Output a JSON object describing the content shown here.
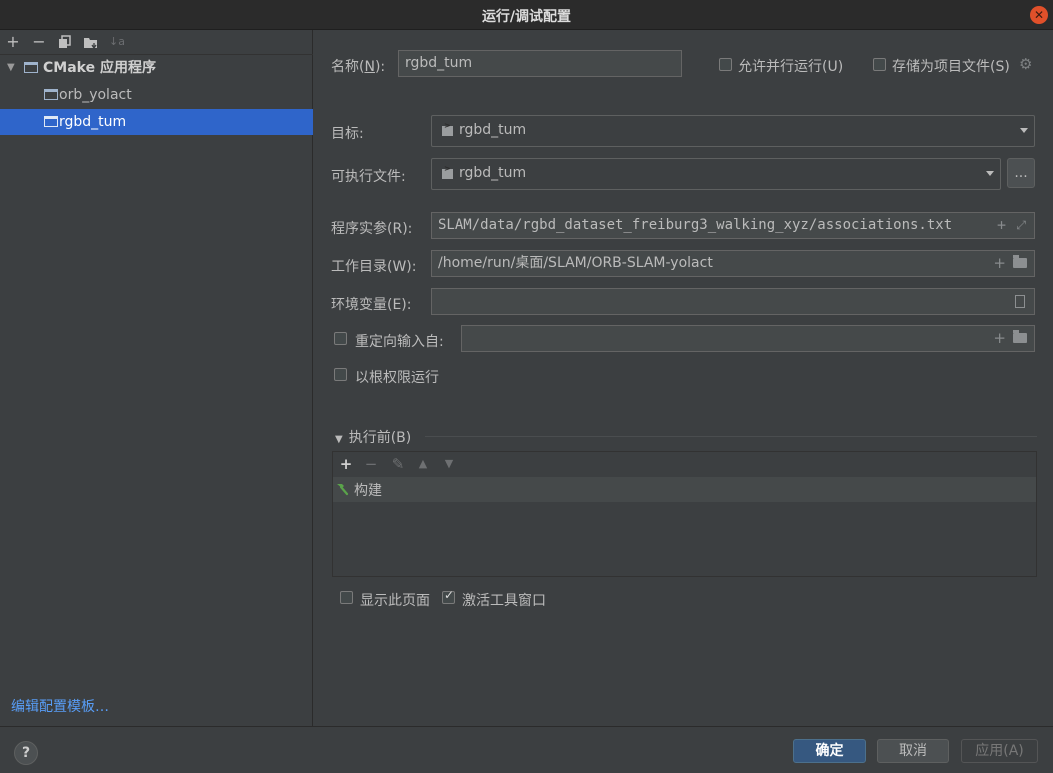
{
  "window": {
    "title": "运行/调试配置"
  },
  "left_panel": {
    "toolbar": [
      "+",
      "−",
      "copy",
      "folder",
      "sort"
    ],
    "group_label": "CMake 应用程序",
    "items": [
      {
        "label": "orb_yolact",
        "selected": false
      },
      {
        "label": "rgbd_tum",
        "selected": true
      }
    ],
    "edit_templates_link": "编辑配置模板…"
  },
  "form": {
    "name_label": "名称(",
    "name_mnemonic": "N",
    "name_label_end": "):",
    "name_value": "rgbd_tum",
    "allow_parallel_label": "允许并行运行(U)",
    "allow_parallel_checked": false,
    "store_as_project_label": "存储为项目文件(S)",
    "store_as_project_checked": false,
    "target_label": "目标:",
    "target_value": "rgbd_tum",
    "executable_label": "可执行文件:",
    "executable_value": "rgbd_tum",
    "dots_label": "...",
    "program_args_label": "程序实参(R):",
    "program_args_value": "SLAM/data/rgbd_dataset_freiburg3_walking_xyz/associations.txt",
    "working_dir_label": "工作目录(W):",
    "working_dir_value": "/home/run/桌面/SLAM/ORB-SLAM-yolact",
    "env_label": "环境变量(E):",
    "env_value": "",
    "redirect_label": "重定向输入自:",
    "redirect_checked": false,
    "redirect_value": "",
    "run_as_root_label": "以根权限运行",
    "run_as_root_checked": false
  },
  "before_launch": {
    "title": "执行前(B)",
    "items": [
      {
        "label": "构建"
      }
    ],
    "show_page_label": "显示此页面",
    "show_page_checked": false,
    "activate_tool_label": "激活工具窗口",
    "activate_tool_checked": true
  },
  "buttons": {
    "help": "?",
    "ok": "确定",
    "cancel": "取消",
    "apply": "应用(A)"
  },
  "colors": {
    "selection": "#2f65ca",
    "link": "#589df6",
    "primary_button": "#365880",
    "close_button": "#e0502a"
  }
}
